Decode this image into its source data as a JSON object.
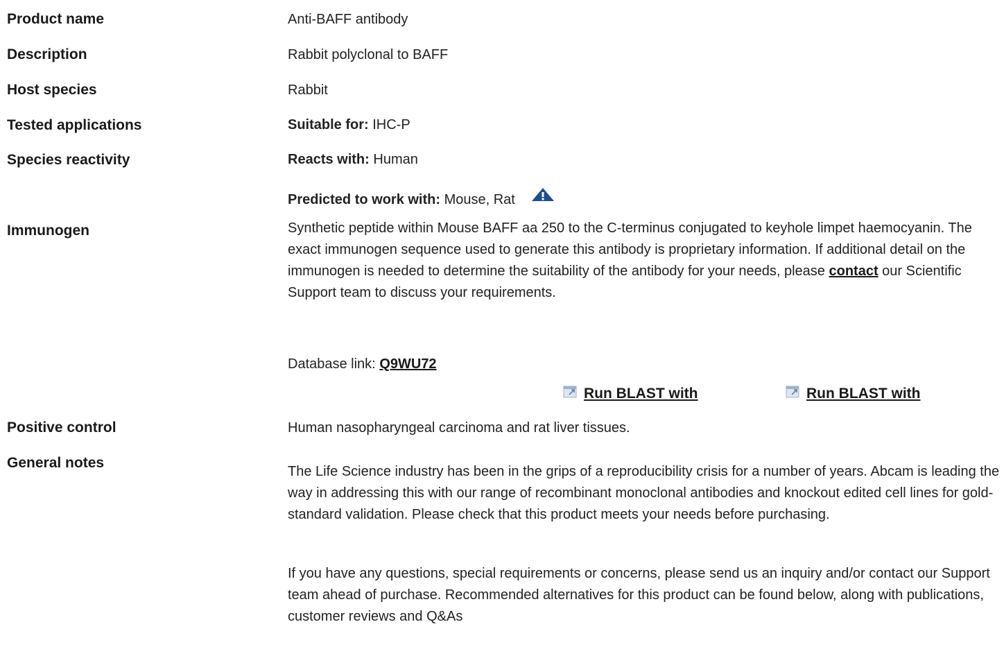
{
  "rows": {
    "product_name": {
      "label": "Product name",
      "value": "Anti-BAFF antibody"
    },
    "description": {
      "label": "Description",
      "value": "Rabbit polyclonal to BAFF"
    },
    "host_species": {
      "label": "Host species",
      "value": "Rabbit"
    },
    "tested_applications": {
      "label": "Tested applications",
      "prefix": "Suitable for:",
      "value": "IHC-P"
    },
    "species_reactivity": {
      "label": "Species reactivity",
      "reacts_prefix": "Reacts with:",
      "reacts_value": "Human",
      "predicted_prefix": "Predicted to work with:",
      "predicted_value": "Mouse, Rat",
      "warning_icon": "warning-triangle-icon"
    },
    "immunogen": {
      "label": "Immunogen",
      "text_before_link": "Synthetic peptide within Mouse BAFF aa 250 to the C-terminus conjugated to keyhole limpet haemocyanin. The exact immunogen sequence used to generate this antibody is proprietary information. If additional detail on the immunogen is needed to determine the suitability of the antibody for your needs, please",
      "contact_link": "contact",
      "text_after_link": "our Scientific Support team to discuss your requirements.",
      "database_prefix": "Database link:",
      "database_link": "Q9WU72",
      "blast_links": [
        "Run BLAST with",
        "Run BLAST with"
      ],
      "blast_icon": "external-link-icon"
    },
    "positive_control": {
      "label": "Positive control",
      "value": "Human nasopharyngeal carcinoma and rat liver tissues."
    },
    "general_notes": {
      "label": "General notes",
      "paragraph_1": "The Life Science industry has been in the grips of a reproducibility crisis for a number of years. Abcam is leading the way in addressing this with our range of recombinant monoclonal antibodies and knockout edited cell lines for gold-standard validation. Please check that this product meets your needs before purchasing.",
      "paragraph_2": "If you have any questions, special requirements or concerns, please send us an inquiry and/or contact our Support team ahead of purchase. Recommended alternatives for this product can be found below, along with publications, customer reviews and Q&As"
    }
  },
  "colors": {
    "text": "#222222",
    "warning_icon": "#1f4e8c"
  }
}
